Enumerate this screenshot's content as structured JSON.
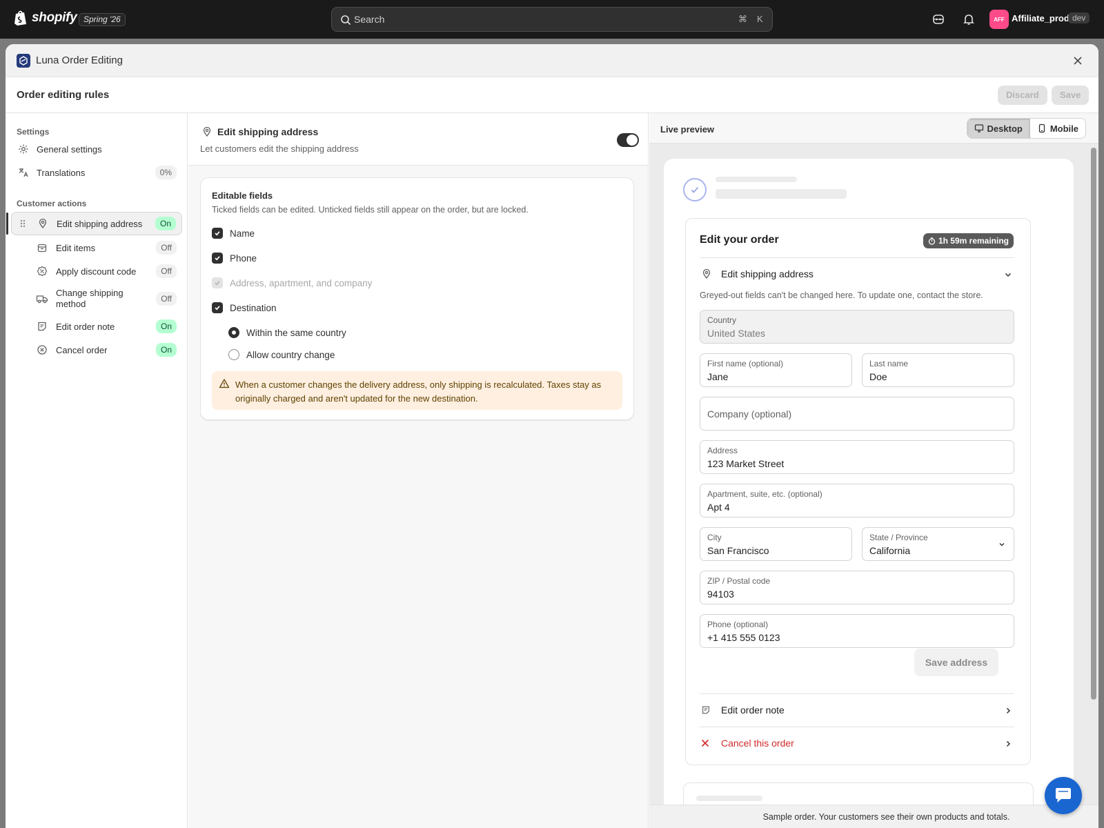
{
  "topbar": {
    "logo_text": "shopify",
    "edition": "Spring '26",
    "search_placeholder": "Search",
    "shortcut_cmd": "⌘",
    "shortcut_key": "K",
    "store_initials": "AFF",
    "store_name": "Affiliate_prod",
    "store_env": "dev"
  },
  "app": {
    "title": "Luna Order Editing"
  },
  "page": {
    "title": "Order editing rules",
    "discard_label": "Discard",
    "save_label": "Save"
  },
  "sidebar": {
    "settings_heading": "Settings",
    "general_settings": "General settings",
    "translations": "Translations",
    "translations_pct": "0%",
    "customer_actions_heading": "Customer actions",
    "actions": [
      {
        "label": "Edit shipping address",
        "status": "On"
      },
      {
        "label": "Edit items",
        "status": "Off"
      },
      {
        "label": "Apply discount code",
        "status": "Off"
      },
      {
        "label": "Change shipping method",
        "status": "Off"
      },
      {
        "label": "Edit order note",
        "status": "On"
      },
      {
        "label": "Cancel order",
        "status": "On"
      }
    ]
  },
  "editor": {
    "title": "Edit shipping address",
    "subtitle": "Let customers edit the shipping address",
    "enabled": true,
    "card_title": "Editable fields",
    "card_subtitle": "Ticked fields can be edited. Unticked fields still appear on the order, but are locked.",
    "fields": [
      {
        "label": "Name",
        "checked": true,
        "disabled": false
      },
      {
        "label": "Phone",
        "checked": true,
        "disabled": false
      },
      {
        "label": "Address, apartment, and company",
        "checked": true,
        "disabled": true
      },
      {
        "label": "Destination",
        "checked": true,
        "disabled": false
      }
    ],
    "destination_options": [
      {
        "label": "Within the same country",
        "selected": true
      },
      {
        "label": "Allow country change",
        "selected": false
      }
    ],
    "warning": "When a customer changes the delivery address, only shipping is recalculated. Taxes stay as originally charged and aren't updated for the new destination."
  },
  "preview": {
    "title": "Live preview",
    "desktop_label": "Desktop",
    "mobile_label": "Mobile",
    "order_title": "Edit your order",
    "timer": "1h 59m remaining",
    "section_title": "Edit shipping address",
    "note": "Greyed-out fields can't be changed here. To update one, contact the store.",
    "country_label": "Country",
    "country_value": "United States",
    "first_name_label": "First name (optional)",
    "first_name_value": "Jane",
    "last_name_label": "Last name",
    "last_name_value": "Doe",
    "company_placeholder": "Company (optional)",
    "address_label": "Address",
    "address_value": "123 Market Street",
    "apt_label": "Apartment, suite, etc. (optional)",
    "apt_value": "Apt 4",
    "city_label": "City",
    "city_value": "San Francisco",
    "state_label": "State / Province",
    "state_value": "California",
    "zip_label": "ZIP / Postal code",
    "zip_value": "94103",
    "phone_label": "Phone (optional)",
    "phone_value": "+1 415 555 0123",
    "save_address": "Save address",
    "edit_note_label": "Edit order note",
    "cancel_label": "Cancel this order",
    "footer": "Sample order. Your customers see their own products and totals."
  },
  "colors": {
    "accent_on": "#b4fed2",
    "cancel_red": "#d12b2b",
    "warning_bg": "#ffefe0",
    "chat_blue": "#1a66d1"
  }
}
